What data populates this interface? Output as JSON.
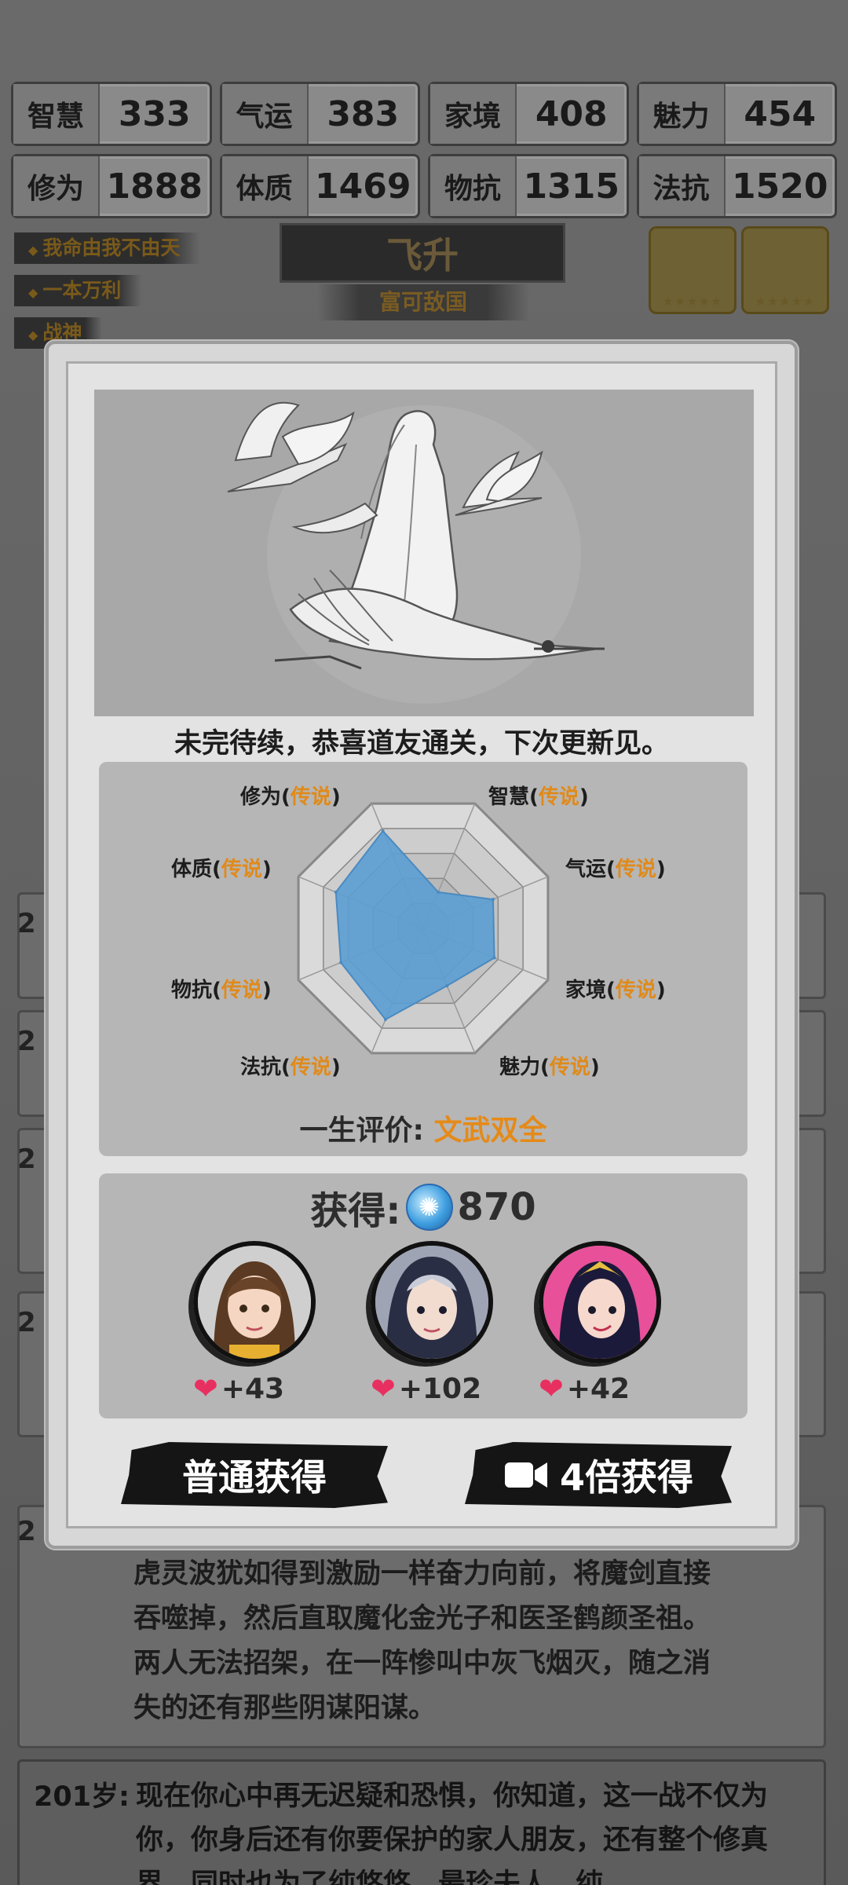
{
  "stats_row1": [
    {
      "name": "智慧",
      "value": "333"
    },
    {
      "name": "气运",
      "value": "383"
    },
    {
      "name": "家境",
      "value": "408"
    },
    {
      "name": "魅力",
      "value": "454"
    }
  ],
  "stats_row2": [
    {
      "name": "修为",
      "value": "1888"
    },
    {
      "name": "体质",
      "value": "1469"
    },
    {
      "name": "物抗",
      "value": "1315"
    },
    {
      "name": "法抗",
      "value": "1520"
    }
  ],
  "tags": [
    "我命由我不由天",
    "一本万利",
    "战神"
  ],
  "status": {
    "title": "飞升",
    "subtitle": "富可敌国"
  },
  "equipment_stars": "★★★★★",
  "modal": {
    "congrats": "未完待续，恭喜道友通关，下次更新见。",
    "radar": {
      "labels": [
        {
          "name": "修为",
          "quality": "传说"
        },
        {
          "name": "智慧",
          "quality": "传说"
        },
        {
          "name": "气运",
          "quality": "传说"
        },
        {
          "name": "家境",
          "quality": "传说"
        },
        {
          "name": "魅力",
          "quality": "传说"
        },
        {
          "name": "法抗",
          "quality": "传说"
        },
        {
          "name": "物抗",
          "quality": "传说"
        },
        {
          "name": "体质",
          "quality": "传说"
        }
      ],
      "values": [
        0.78,
        0.29,
        0.56,
        0.57,
        0.46,
        0.73,
        0.66,
        0.7
      ],
      "fill_color": "#5b9fd4",
      "ring_color": "#888888"
    },
    "evaluation_label": "一生评价:",
    "evaluation_value": "文武双全",
    "reward_label": "获得:",
    "reward_amount": "870",
    "partners": [
      {
        "affection": "+43"
      },
      {
        "affection": "+102"
      },
      {
        "affection": "+42"
      }
    ],
    "buttons": {
      "normal": "普通获得",
      "video": "4倍获得"
    }
  },
  "log": {
    "age_prefix": "2",
    "story_text": [
      "虎灵波犹如得到激励一样奋力向前，将魔剑直接",
      "吞噬掉，然后直取魔化金光子和医圣鹤颜圣祖。",
      "两人无法招架，在一阵惨叫中灰飞烟灭，随之消",
      "失的还有那些阴谋阳谋。"
    ],
    "next_age": "201岁:",
    "next_text": "现在你心中再无迟疑和恐惧，你知道，这一战不仅为你，你身后还有你要保护的家人朋友，还有整个修真界，同时也为了纯悠悠，最珍夫人，纯"
  }
}
